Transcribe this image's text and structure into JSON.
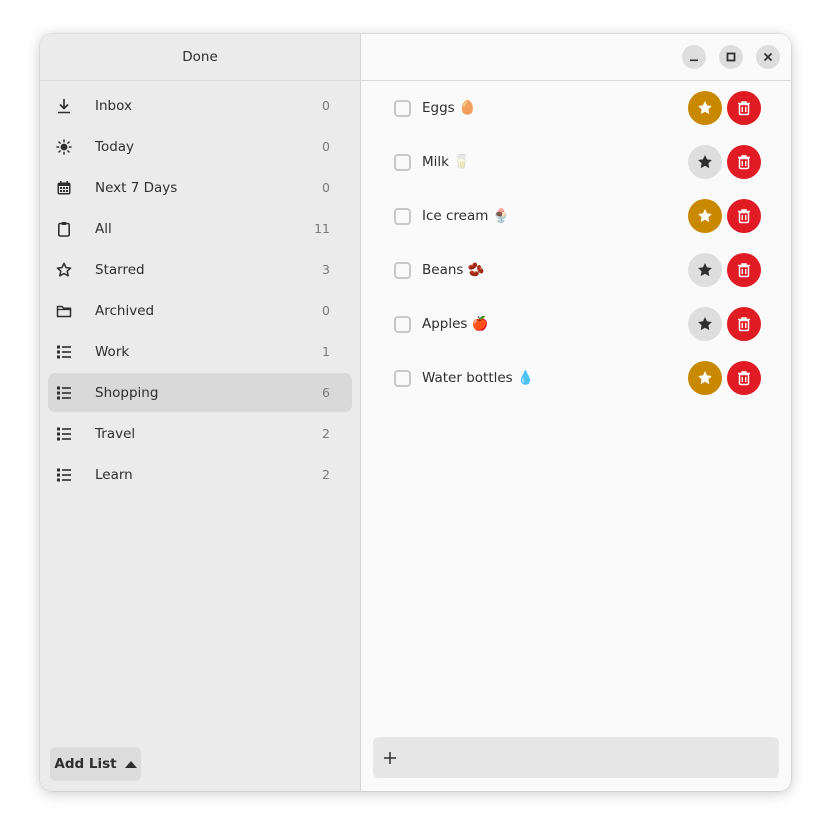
{
  "sidebar": {
    "title": "Done",
    "items": [
      {
        "label": "Inbox",
        "count": "0",
        "icon": "download-icon"
      },
      {
        "label": "Today",
        "count": "0",
        "icon": "sun-icon"
      },
      {
        "label": "Next 7 Days",
        "count": "0",
        "icon": "calendar-icon"
      },
      {
        "label": "All",
        "count": "11",
        "icon": "clipboard-icon"
      },
      {
        "label": "Starred",
        "count": "3",
        "icon": "star-outline-icon"
      },
      {
        "label": "Archived",
        "count": "0",
        "icon": "folder-icon"
      },
      {
        "label": "Work",
        "count": "1",
        "icon": "list-icon"
      },
      {
        "label": "Shopping",
        "count": "6",
        "icon": "list-icon"
      },
      {
        "label": "Travel",
        "count": "2",
        "icon": "list-icon"
      },
      {
        "label": "Learn",
        "count": "2",
        "icon": "list-icon"
      }
    ],
    "selected": "Shopping",
    "add_list_label": "Add List"
  },
  "window_controls": [
    "minimize-icon",
    "maximize-icon",
    "close-icon"
  ],
  "tasks": [
    {
      "label": "Eggs 🥚",
      "starred": true
    },
    {
      "label": "Milk 🥛",
      "starred": false
    },
    {
      "label": "Ice cream 🍨",
      "starred": true
    },
    {
      "label": "Beans 🫘",
      "starred": false
    },
    {
      "label": "Apples 🍎",
      "starred": false
    },
    {
      "label": "Water bottles 💧",
      "starred": true
    }
  ],
  "colors": {
    "star_active": "#c88800",
    "star_inactive": "#dedede",
    "delete": "#e01b24",
    "selected_row": "#d9d9d9"
  }
}
